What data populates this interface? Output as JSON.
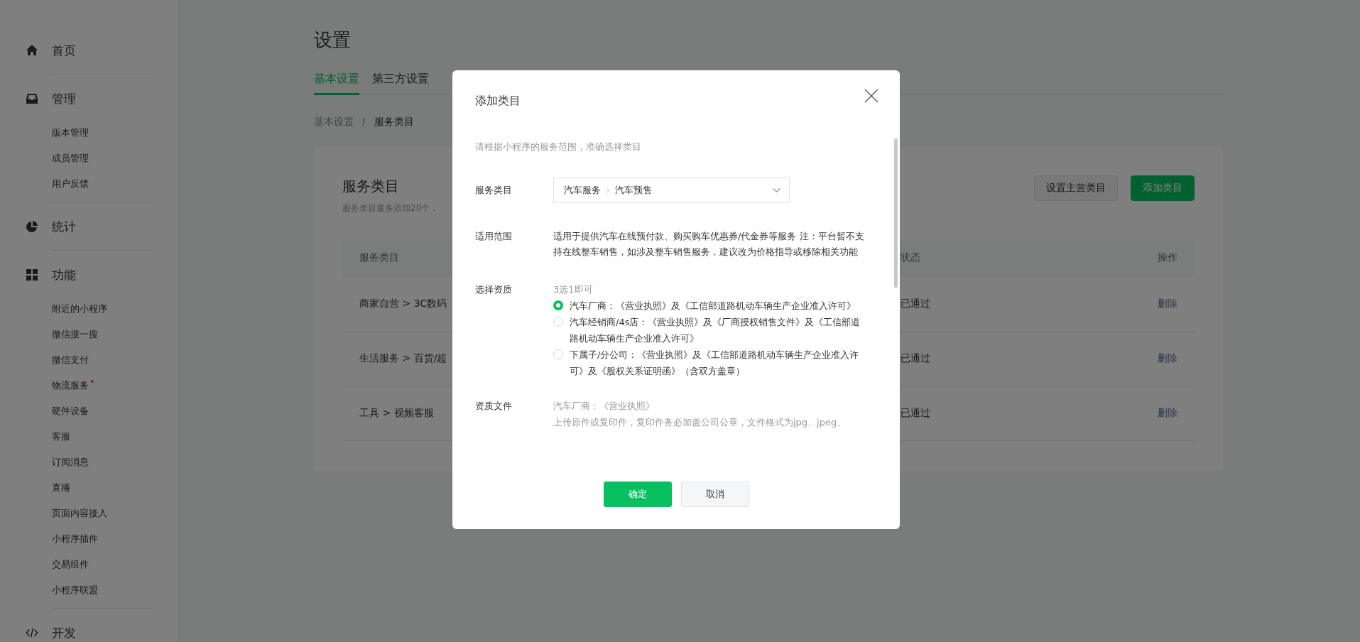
{
  "sidebar": {
    "sections": [
      {
        "label": "首页",
        "kind": "home"
      },
      {
        "label": "管理",
        "kind": "inbox",
        "items": [
          {
            "label": "版本管理",
            "dot": false
          },
          {
            "label": "成员管理",
            "dot": false
          },
          {
            "label": "用户反馈",
            "dot": false
          }
        ]
      },
      {
        "label": "统计",
        "kind": "pie"
      },
      {
        "label": "功能",
        "kind": "grid",
        "items": [
          {
            "label": "附近的小程序",
            "dot": false
          },
          {
            "label": "微信搜一搜",
            "dot": false
          },
          {
            "label": "微信支付",
            "dot": false
          },
          {
            "label": "物流服务",
            "dot": true
          },
          {
            "label": "硬件设备",
            "dot": false
          },
          {
            "label": "客服",
            "dot": false
          },
          {
            "label": "订阅消息",
            "dot": false
          },
          {
            "label": "直播",
            "dot": false
          },
          {
            "label": "页面内容接入",
            "dot": false
          },
          {
            "label": "小程序插件",
            "dot": false
          },
          {
            "label": "交易组件",
            "dot": false
          },
          {
            "label": "小程序联盟",
            "dot": false
          }
        ]
      },
      {
        "label": "开发",
        "kind": "code"
      }
    ]
  },
  "page": {
    "title": "设置",
    "tabs": [
      {
        "label": "基本设置",
        "selected": true
      },
      {
        "label": "第三方设置",
        "selected": false
      }
    ],
    "breadcrumb": {
      "items": [
        "基本设置",
        "服务类目"
      ],
      "separator": "/"
    }
  },
  "card": {
    "title": "服务类目",
    "subtitle": "服务类目最多添加20个，",
    "buttons": [
      {
        "label": "设置主营类目",
        "kind": "secondary"
      },
      {
        "label": "添加类目",
        "kind": "primary"
      }
    ],
    "table": {
      "columns": [
        "服务类目",
        "状态",
        "操作"
      ],
      "rows": [
        {
          "category": "商家自营 > 3C数码",
          "status": "已通过",
          "action": "删除"
        },
        {
          "category": "生活服务 > 百货/超",
          "status": "已通过",
          "action": "删除"
        },
        {
          "category": "工具 > 视频客服",
          "status": "已通过",
          "action": "删除"
        }
      ]
    }
  },
  "dialog": {
    "title": "添加类目",
    "hint": "请根据小程序的服务范围，准确选择类目",
    "fields": [
      {
        "label": "服务类目",
        "kind": "select",
        "path": [
          "汽车服务",
          "汽车预售"
        ]
      },
      {
        "label": "适用范围",
        "kind": "text",
        "text": "适用于提供汽车在线预付款、购买购车优惠券/代金券等服务 注：平台暂不支持在线整车销售，如涉及整车销售服务，建议改为价格指导或移除相关功能"
      },
      {
        "label": "选择资质",
        "kind": "radio",
        "note": "3选1即可",
        "options": [
          {
            "label": "汽车厂商：《营业执照》及《工信部道路机动车辆生产企业准入许可》",
            "selected": true
          },
          {
            "label": "汽车经销商/4s店：《营业执照》及《厂商授权销售文件》及《工信部道路机动车辆生产企业准入许可》",
            "selected": false
          },
          {
            "label": "下属子/分公司：《营业执照》及《工信部道路机动车辆生产企业准入许可》及《股权关系证明函》（含双方盖章）",
            "selected": false
          }
        ]
      },
      {
        "label": "资质文件",
        "kind": "notes",
        "lines": [
          "汽车厂商：《营业执照》",
          "上传原件或复印件，复印件务必加盖公司公章，文件格式为jpg、jpeg、"
        ]
      }
    ],
    "buttons": [
      {
        "label": "确定",
        "kind": "primary"
      },
      {
        "label": "取消",
        "kind": "secondary"
      }
    ]
  }
}
